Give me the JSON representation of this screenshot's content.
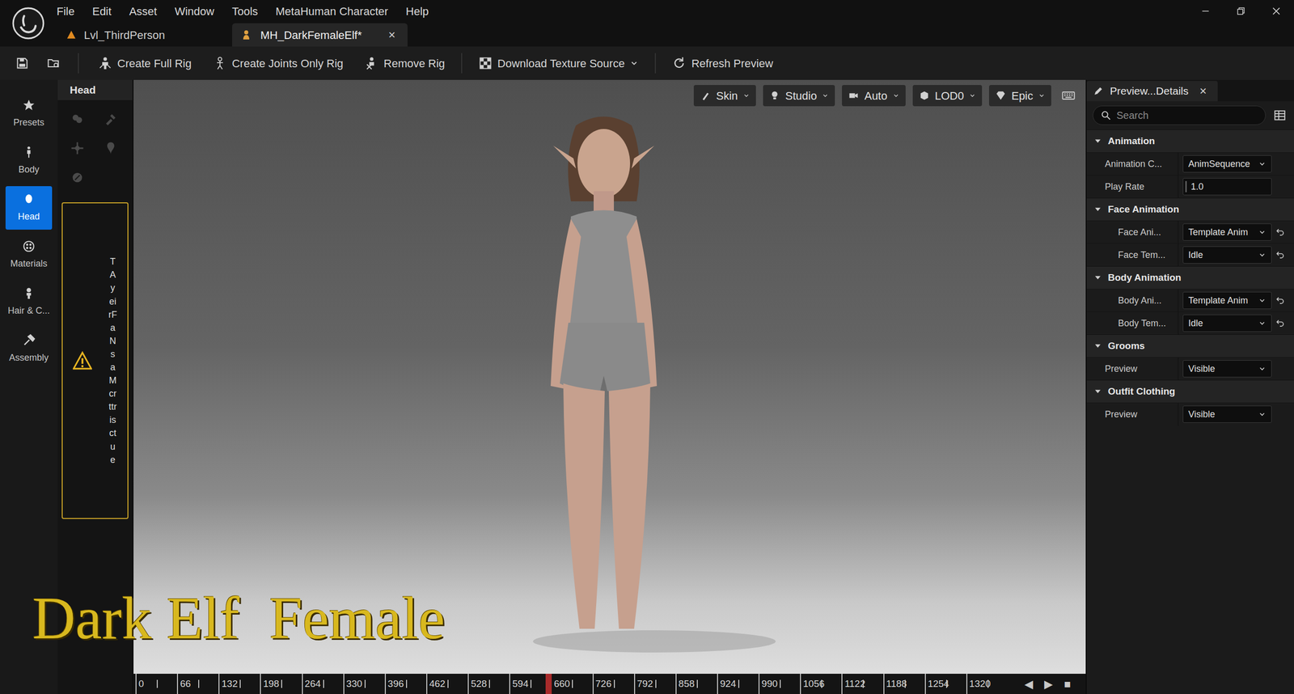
{
  "menu": [
    "File",
    "Edit",
    "Asset",
    "Window",
    "Tools",
    "MetaHuman Character",
    "Help"
  ],
  "tabs": [
    {
      "label": "Lvl_ThirdPerson",
      "selected": false
    },
    {
      "label": "MH_DarkFemaleElf*",
      "selected": true
    }
  ],
  "tab_close": "×",
  "toolbar": {
    "buttons": [
      {
        "label": "Create Full Rig",
        "menu": false
      },
      {
        "label": "Create Joints Only Rig",
        "menu": false
      },
      {
        "label": "Remove Rig",
        "menu": false
      },
      {
        "label": "Download Texture Source",
        "menu": true
      },
      {
        "label": "Refresh Preview",
        "menu": false
      }
    ]
  },
  "categories": [
    {
      "label": "Presets",
      "selected": false
    },
    {
      "label": "Body",
      "selected": false
    },
    {
      "label": "Head",
      "selected": true
    },
    {
      "label": "Materials",
      "selected": false
    },
    {
      "label": "Hair & C...",
      "selected": false
    },
    {
      "label": "Assembly",
      "selected": false
    }
  ],
  "head_panel": {
    "title": "Head",
    "warning": "TAyeirFaNsaMcrttrisctue"
  },
  "viewport": {
    "controls": [
      "Skin",
      "Studio",
      "Auto",
      "LOD0",
      "Epic"
    ],
    "caption": "Dark Elf  Female"
  },
  "timeline": {
    "ticks": [
      "0",
      "66",
      "132",
      "198",
      "264",
      "330",
      "396",
      "462",
      "528",
      "594",
      "660",
      "726",
      "792",
      "858",
      "924",
      "990",
      "1056",
      "1122",
      "1188",
      "1254",
      "1320"
    ],
    "playhead": 0.47,
    "transport": [
      "◀",
      "▶",
      "■"
    ]
  },
  "details": {
    "title": "Preview...Details",
    "close": "×",
    "search": {
      "placeholder": "Search"
    },
    "sections": [
      {
        "title": "Animation",
        "expanded": true,
        "rows": [
          {
            "label": "Animation C...",
            "value": "AnimSequence",
            "kind": "dropdown",
            "reset": false
          },
          {
            "label": "Play Rate",
            "value": "1.0",
            "kind": "number",
            "reset": false
          }
        ]
      },
      {
        "title": "Face Animation",
        "expanded": true,
        "rows": [
          {
            "label": "Face Ani...",
            "value": "Template Anim",
            "kind": "dropdown",
            "reset": true
          },
          {
            "label": "Face Tem...",
            "value": "Idle",
            "kind": "dropdown",
            "reset": true
          }
        ]
      },
      {
        "title": "Body Animation",
        "expanded": true,
        "rows": [
          {
            "label": "Body Ani...",
            "value": "Template Anim",
            "kind": "dropdown",
            "reset": true
          },
          {
            "label": "Body Tem...",
            "value": "Idle",
            "kind": "dropdown",
            "reset": true
          }
        ]
      },
      {
        "title": "Grooms",
        "expanded": true,
        "rows": [
          {
            "label": "Preview",
            "value": "Visible",
            "kind": "dropdown",
            "reset": false
          }
        ]
      },
      {
        "title": "Outfit Clothing",
        "expanded": true,
        "rows": [
          {
            "label": "Preview",
            "value": "Visible",
            "kind": "dropdown",
            "reset": false
          }
        ]
      }
    ]
  }
}
